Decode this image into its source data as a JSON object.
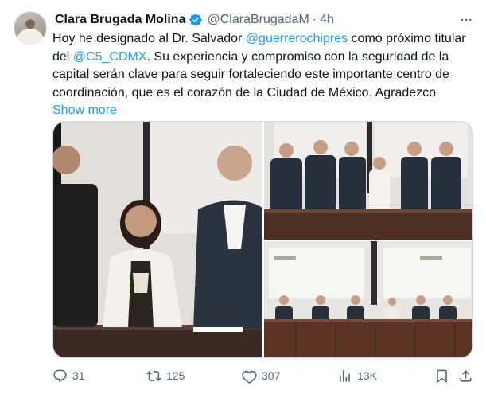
{
  "author": {
    "display_name": "Clara Brugada Molina",
    "handle": "@ClaraBrugadaM",
    "separator": "·",
    "time": "4h"
  },
  "body": {
    "line_parts": [
      "Hoy he designado al Dr. Salvador ",
      "@guerrerochipres",
      " como próximo titular del ",
      "@C5_CDMX",
      ". Su experiencia y compromiso con la seguridad de la capital serán clave para seguir fortaleciendo este importante centro de coordinación, que es el corazón de la Ciudad de México. Agradezco"
    ],
    "show_more": "Show more"
  },
  "actions": {
    "replies": "31",
    "reposts": "125",
    "likes": "307",
    "views": "13K"
  },
  "colors": {
    "link": "#1d9bf0",
    "muted": "#536471",
    "text": "#0f1419"
  },
  "icons": [
    "verified-badge-icon",
    "more-icon",
    "reply-icon",
    "retweet-icon",
    "like-icon",
    "views-icon",
    "bookmark-icon",
    "share-icon"
  ]
}
